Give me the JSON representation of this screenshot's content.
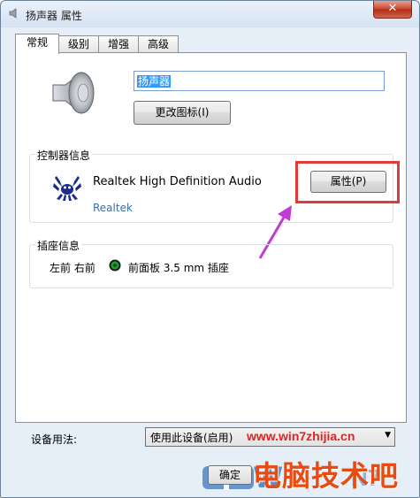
{
  "window": {
    "title": "扬声器 属性",
    "close_label": "✕"
  },
  "tabs": [
    {
      "label": "常规",
      "active": true
    },
    {
      "label": "级别",
      "active": false
    },
    {
      "label": "增强",
      "active": false
    },
    {
      "label": "高级",
      "active": false
    }
  ],
  "general": {
    "device_name": "扬声器",
    "change_icon_label": "更改图标(I)"
  },
  "controller": {
    "group_title": "控制器信息",
    "device": "Realtek High Definition Audio",
    "vendor_link": "Realtek",
    "properties_label": "属性(P)"
  },
  "jack": {
    "group_title": "插座信息",
    "positions": "左前 右前",
    "description": "前面板 3.5 mm 插座"
  },
  "usage": {
    "label": "设备用法:",
    "selected": "使用此设备(启用)"
  },
  "footer": {
    "ok_label": "确定"
  },
  "watermark": {
    "url": "www.win7zhijia.cn",
    "brand": "电脑技术吧"
  },
  "colors": {
    "highlight": "#e03a3a",
    "link": "#3a6ea5",
    "arrow": "#c23bd8",
    "jack_green": "#17a32e"
  }
}
